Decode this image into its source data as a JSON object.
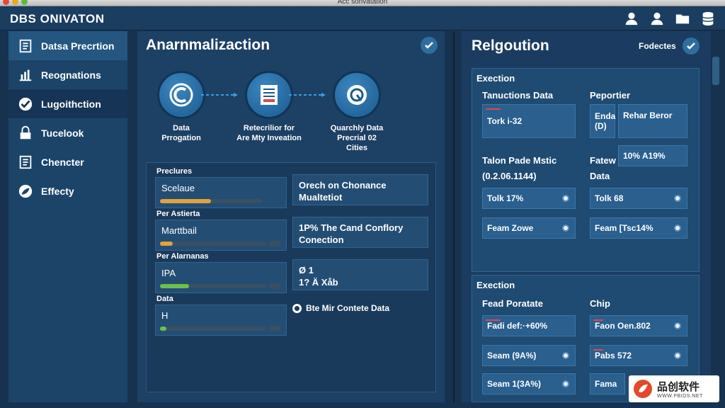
{
  "window": {
    "title": "Aсс sonvatation"
  },
  "header": {
    "app_title": "DBS ONIVATON",
    "icons": [
      "user-icon",
      "user-icon",
      "folder-icon",
      "database-icon"
    ]
  },
  "sidebar": {
    "items": [
      {
        "label": "Datsa Precrtion",
        "icon": "document-icon"
      },
      {
        "label": "Reognations",
        "icon": "chart-icon"
      },
      {
        "label": "Lugoithction",
        "icon": "check-icon"
      },
      {
        "label": "Tucelook",
        "icon": "lock-icon"
      },
      {
        "label": "Chencter",
        "icon": "document-icon"
      },
      {
        "label": "Effecty",
        "icon": "leaf-icon"
      }
    ]
  },
  "main": {
    "title": "Anarnmalizaction",
    "flow": [
      {
        "label_1": "Data",
        "label_2": "Prrogation",
        "icon": "cloud-icon"
      },
      {
        "label_1": "Retecrilior for",
        "label_2": "Are Mty Inveation",
        "icon": "list-icon"
      },
      {
        "label_1": "Quarchly Data",
        "label_2": "Precrial 02",
        "label_3": "Cities",
        "icon": "gear-icon"
      }
    ],
    "metrics": [
      {
        "group": "Preclures",
        "name": "Scelaue",
        "fill": 0.5,
        "color": "#e0a23a"
      },
      {
        "group": "Per Astierta",
        "name": "Marttbail",
        "fill": 0.12,
        "color": "#e0a23a"
      },
      {
        "group": "Per Alarnanas",
        "name": "IPA",
        "fill": 0.27,
        "color": "#6cc04a"
      },
      {
        "group": "Data",
        "name": "H",
        "fill": 0.06,
        "color": "#6cc04a"
      }
    ],
    "info": [
      {
        "line_1": "Orech on Chonance",
        "line_2": "Mualtetiot"
      },
      {
        "line_1": "1P% The Cand Conflory",
        "line_2": "Conection"
      },
      {
        "line_1": "Ø 1",
        "line_2": "1? Ä Xåb"
      }
    ],
    "option_label": "Bte Mir Contete Data"
  },
  "right": {
    "title": "Relgoution",
    "top_label": "Fodectes",
    "section1": {
      "title": "Exection",
      "col1": "Tanuctions Data",
      "col2": "Peportier",
      "cards": [
        {
          "text": "Tork i-32"
        },
        {
          "text": "Enda",
          "sub": "(D)"
        },
        {
          "text": "Rehar Beror"
        },
        {
          "text": "10% A19%"
        },
        {
          "text": "Talon Pade Mstic"
        },
        {
          "text": "(0.2.06.1144)"
        },
        {
          "text": "Fatew"
        },
        {
          "text": "Data"
        },
        {
          "text": "Tolk 17%"
        },
        {
          "text": "Tolk 68"
        },
        {
          "text": "Feam Zowe"
        },
        {
          "text": "Feam [Tsc14%"
        }
      ]
    },
    "section2": {
      "title": "Exection",
      "col1": "Fead Poratate",
      "col2": "Chip",
      "cards": [
        {
          "text": "Fadi def:·+60%"
        },
        {
          "text": "Faon Oen.802"
        },
        {
          "text": "Seam (9A%)"
        },
        {
          "text": "Pabs 572"
        },
        {
          "text": "Seam 1(3A%)"
        },
        {
          "text": "Fama"
        }
      ]
    }
  },
  "watermark": {
    "main": "品创软件",
    "sub": "WWW.PBIDS.NET"
  },
  "colors": {
    "accent": "#2e6d9e",
    "bar_orange": "#e0a23a",
    "bar_green": "#6cc04a"
  }
}
